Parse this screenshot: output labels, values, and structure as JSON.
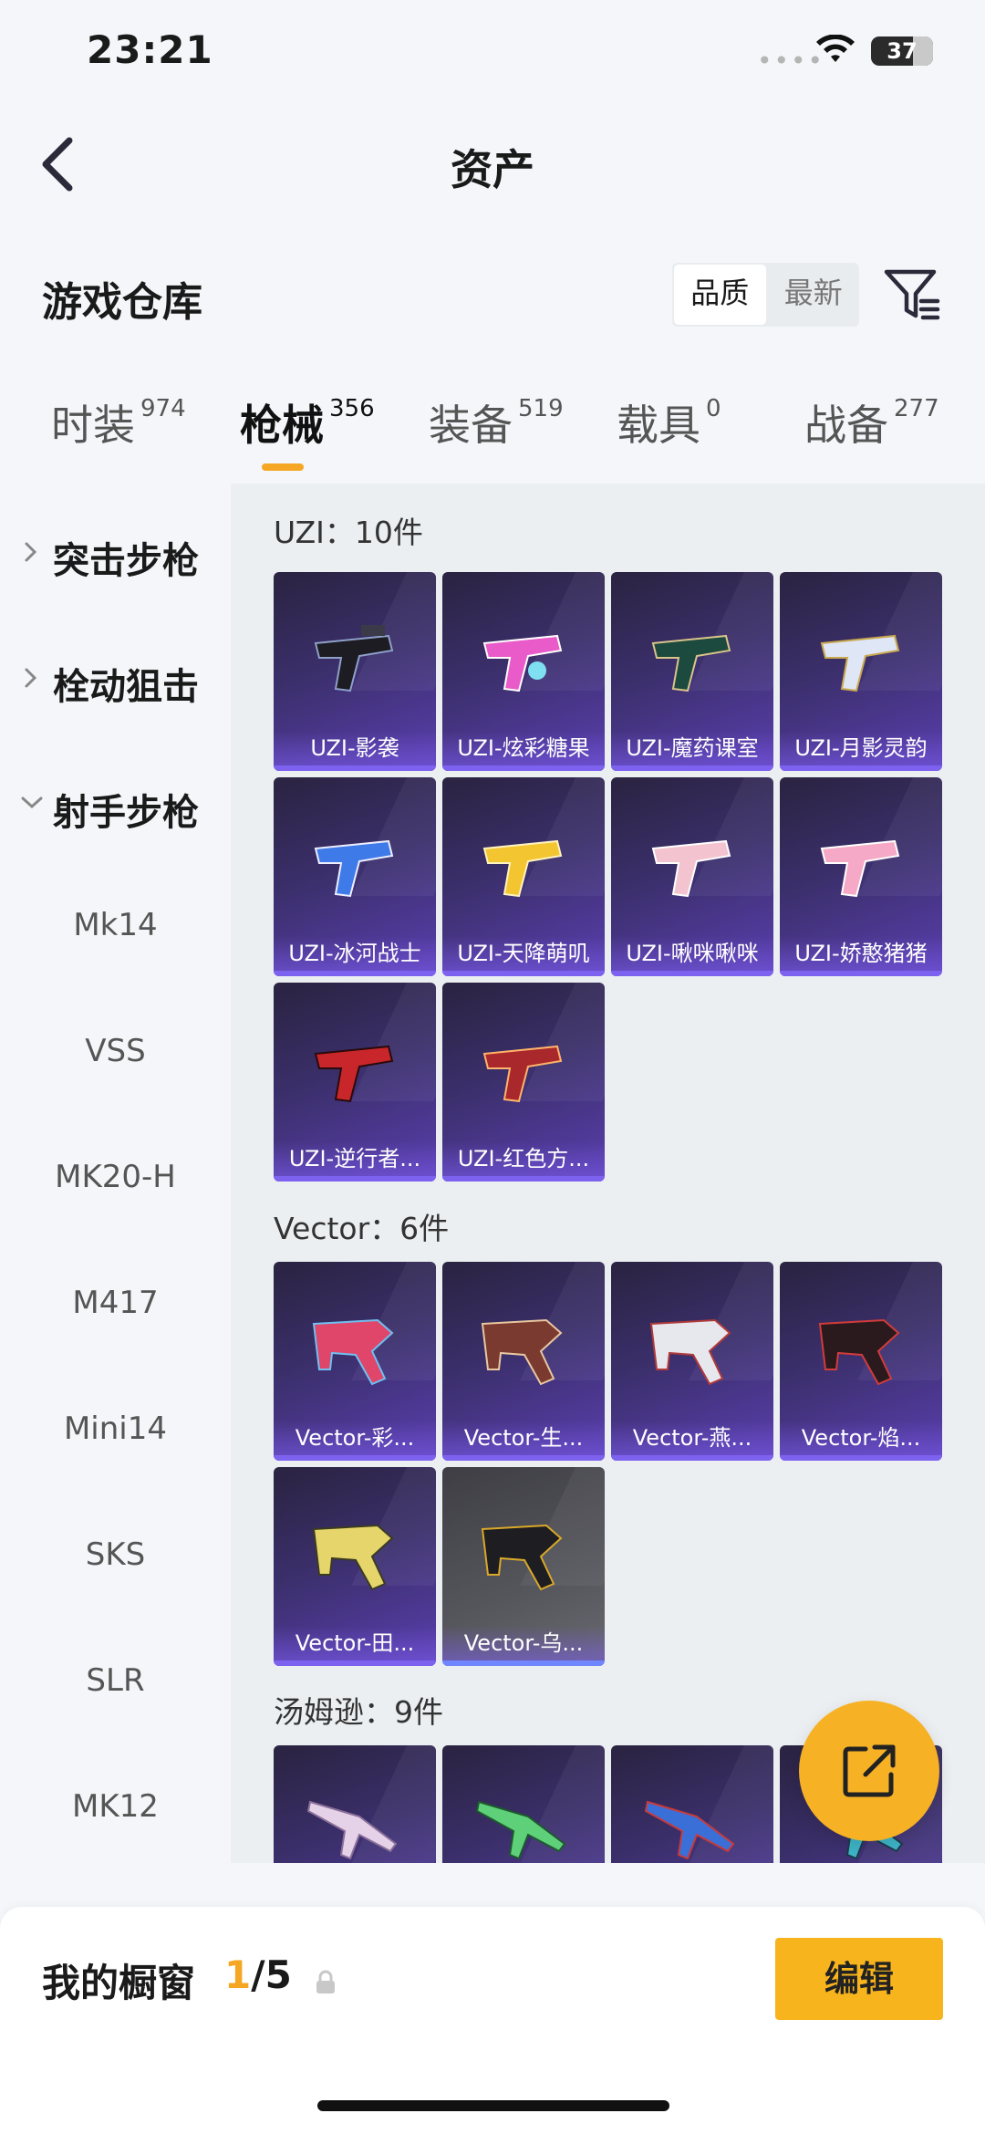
{
  "status": {
    "time": "23:21",
    "battery": "37"
  },
  "header": {
    "title": "资产"
  },
  "warehouse": {
    "title": "游戏仓库",
    "sort_options": [
      "品质",
      "最新"
    ],
    "active_sort": "品质"
  },
  "tabs": [
    {
      "label": "时装",
      "count": "974"
    },
    {
      "label": "枪械",
      "count": "356"
    },
    {
      "label": "装备",
      "count": "519"
    },
    {
      "label": "载具",
      "count": "0"
    },
    {
      "label": "战备",
      "count": "277"
    }
  ],
  "sidebar": {
    "categories": [
      {
        "label": "突击步枪",
        "expanded": false
      },
      {
        "label": "栓动狙击",
        "expanded": false
      },
      {
        "label": "射手步枪",
        "expanded": true
      }
    ],
    "subitems": [
      "Mk14",
      "VSS",
      "MK20-H",
      "M417",
      "Mini14",
      "SKS",
      "SLR",
      "MK12"
    ]
  },
  "groups": [
    {
      "title": "UZI：10件",
      "items": [
        "UZI-影袭",
        "UZI-炫彩糖果",
        "UZI-魔药课室",
        "UZI-月影灵韵",
        "UZI-冰河战士",
        "UZI-天降萌叽",
        "UZI-啾咪啾咪",
        "UZI-娇憨猪猪",
        "UZI-逆行者...",
        "UZI-红色方..."
      ]
    },
    {
      "title": "Vector：6件",
      "items": [
        "Vector-彩...",
        "Vector-生...",
        "Vector-燕...",
        "Vector-焰...",
        "Vector-田...",
        "Vector-乌..."
      ]
    },
    {
      "title": "汤姆逊：9件",
      "items": [
        "",
        "",
        "",
        ""
      ]
    }
  ],
  "bottom": {
    "showcase_label": "我的橱窗",
    "showcase_current": "1",
    "showcase_total": "/5",
    "edit_label": "编辑"
  },
  "colors": {
    "accent": "#f5a623",
    "card_purple": "#5a3fb0",
    "edit_button": "#f8b41d"
  }
}
